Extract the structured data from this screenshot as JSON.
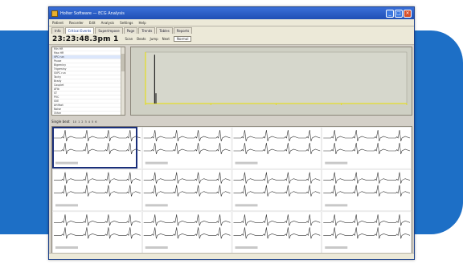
{
  "window": {
    "title": "Holter Software — ECG Analysis",
    "buttons": {
      "minimize": "_",
      "maximize": "□",
      "close": "×"
    }
  },
  "menubar": {
    "items": [
      "Patient",
      "Recorder",
      "Edit",
      "Analysis",
      "Settings",
      "Help"
    ]
  },
  "tabs": {
    "items": [
      {
        "label": "Info",
        "active": false
      },
      {
        "label": "Critical Events",
        "active": true
      },
      {
        "label": "Superimpose",
        "active": false
      },
      {
        "label": "Page",
        "active": false
      },
      {
        "label": "Trends",
        "active": false
      },
      {
        "label": "Tables",
        "active": false
      },
      {
        "label": "Reports",
        "active": false
      }
    ]
  },
  "toolbar": {
    "time": "23:23:48.3pm 1",
    "buttons": [
      "Scan",
      "Beats",
      "Jump",
      "Next"
    ],
    "dropdown": "Normal"
  },
  "listbox": {
    "items": [
      "Min HR",
      "Max HR",
      "VPC run",
      "Pause",
      "Bigeminy",
      "Trigeminy",
      "SVPC run",
      "Tachy",
      "Brady",
      "Couplet",
      "AFib",
      "ST",
      "PVC",
      "SVE",
      "Artifact",
      "Noise",
      "Other"
    ],
    "selected_index": 2
  },
  "chart_data": {
    "type": "bar",
    "title": "",
    "xlabel": "",
    "ylabel": "",
    "accent": "#e8e000",
    "x": [
      0,
      500,
      1000,
      1500,
      2000
    ],
    "spike_x": 70,
    "ylim": [
      0,
      100
    ],
    "values": [
      {
        "x": 70,
        "y": 95
      },
      {
        "x": 80,
        "y": 20
      }
    ]
  },
  "segbar": {
    "label": "Single beat",
    "small": [
      "10",
      "1",
      "2",
      "3",
      "4",
      "5",
      "6"
    ]
  },
  "ecg": {
    "rows": 3,
    "cols": 4,
    "trace_color": "#333333",
    "highlight_color": "#1a2f7a"
  },
  "statusbar": {
    "cells": [
      "",
      "",
      ""
    ]
  }
}
